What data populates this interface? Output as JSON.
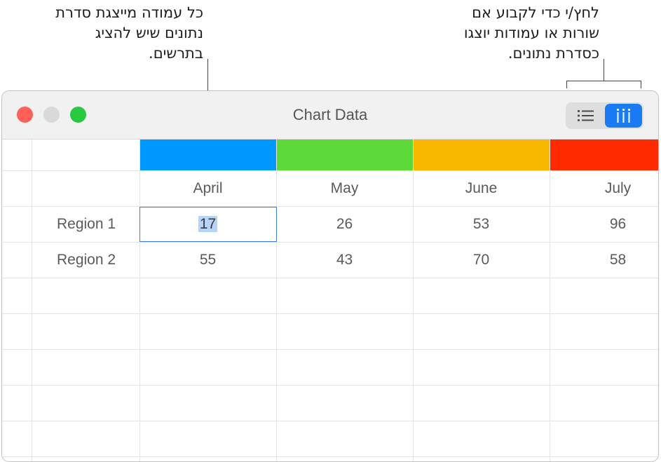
{
  "callouts": {
    "left": "כל עמודה מייצגת סדרת\nנתונים שיש להציג\nבתרשים.",
    "right": "לחץ/י כדי לקבוע אם\nשורות או עמודות יוצגו\nכסדרת נתונים."
  },
  "window": {
    "title": "Chart Data",
    "traffic_lights": {
      "close": "#fe5f57",
      "minimize": "#d9d9d9",
      "zoom": "#28c840"
    },
    "segmented": {
      "rows_icon": "list-rows-icon",
      "columns_icon": "columns-icon",
      "selected": "columns",
      "accent": "#1a7cf5"
    }
  },
  "table": {
    "columns": [
      {
        "label": "April",
        "color": "#0099ff"
      },
      {
        "label": "May",
        "color": "#5dd93a"
      },
      {
        "label": "June",
        "color": "#f8b800"
      },
      {
        "label": "July",
        "color": "#ff2a00"
      }
    ],
    "rows": [
      {
        "label": "Region 1",
        "values": [
          "17",
          "26",
          "53",
          "96"
        ]
      },
      {
        "label": "Region 2",
        "values": [
          "55",
          "43",
          "70",
          "58"
        ]
      }
    ],
    "selected_cell": {
      "row": 0,
      "col": 0
    }
  }
}
